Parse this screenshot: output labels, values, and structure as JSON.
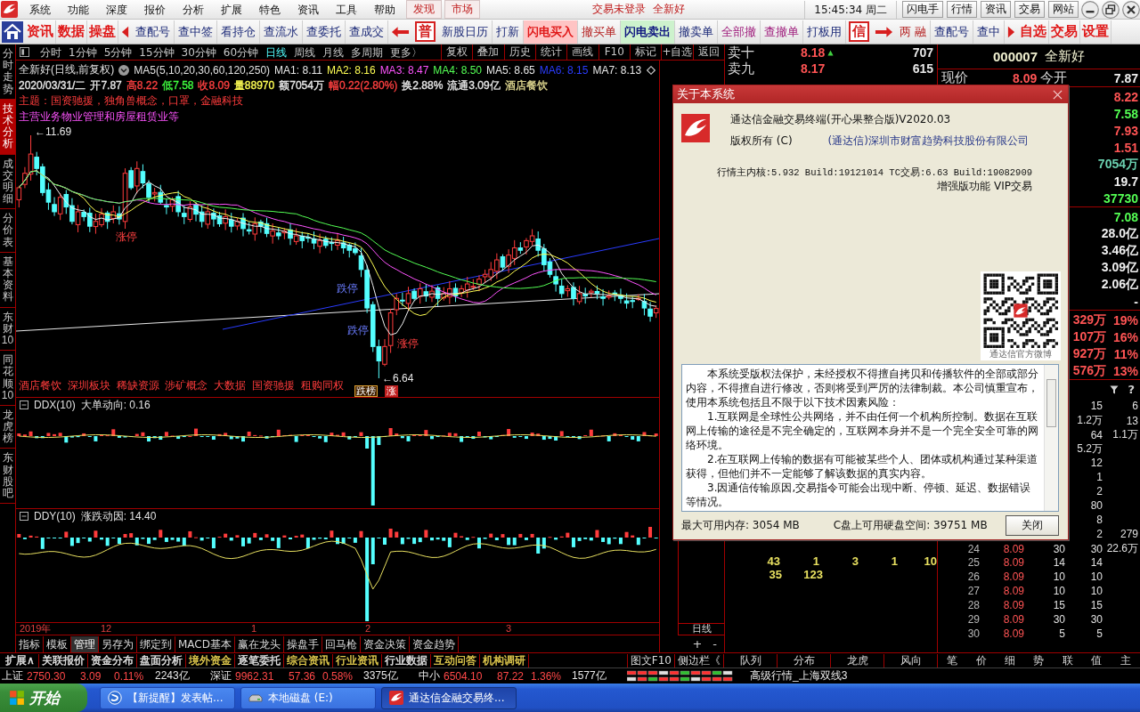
{
  "menu_bar": {
    "menus": [
      "系统",
      "功能",
      "深度",
      "报价",
      "分析",
      "扩展",
      "特色",
      "资讯",
      "工具",
      "帮助"
    ],
    "tabs": [
      "发现",
      "市场"
    ],
    "login_status": "交易未登录",
    "stock": "全新好",
    "clock": "15:45:34 周二",
    "buttons": [
      "闪电手",
      "行情",
      "资讯",
      "交易",
      "网站"
    ]
  },
  "toolbar": {
    "primary": [
      "资讯",
      "数据",
      "操盘"
    ],
    "queries": [
      "查配号",
      "查中签",
      "看持仓",
      "查流水",
      "查委托",
      "查成交"
    ],
    "mode_badge": "普",
    "trade": [
      {
        "label": "新股日历",
        "kind": "plain"
      },
      {
        "label": "打新",
        "kind": "plain"
      },
      {
        "label": "闪电买入",
        "kind": "buy"
      },
      {
        "label": "撤买单",
        "kind": "cancel"
      },
      {
        "label": "闪电卖出",
        "kind": "sell"
      },
      {
        "label": "撤卖单",
        "kind": "plain"
      },
      {
        "label": "全部撤",
        "kind": "revoke"
      },
      {
        "label": "查撤单",
        "kind": "revoke"
      },
      {
        "label": "打板用",
        "kind": "plain"
      }
    ],
    "credit_badge": "信",
    "credit": [
      {
        "label": "两 融",
        "kind": "cancel"
      },
      {
        "label": "查配号",
        "kind": "plain"
      },
      {
        "label": "查中",
        "kind": "plain"
      }
    ],
    "shortcuts": [
      "自选",
      "交易",
      "设置"
    ]
  },
  "side_tabs": [
    {
      "label": "分时走势",
      "selected": false
    },
    {
      "label": "技术分析",
      "selected": true
    },
    {
      "label": "成交明细",
      "selected": false
    },
    {
      "label": "分价表",
      "selected": false
    },
    {
      "label": "基本资料",
      "selected": false
    },
    {
      "label": "东财10",
      "selected": false
    },
    {
      "label": "同花顺10",
      "selected": false
    },
    {
      "label": "龙虎榜",
      "selected": false
    },
    {
      "label": "东财股吧",
      "selected": false
    }
  ],
  "period_tabs": [
    {
      "label": "分时",
      "selected": false
    },
    {
      "label": "1分钟",
      "selected": false
    },
    {
      "label": "5分钟",
      "selected": false
    },
    {
      "label": "15分钟",
      "selected": false
    },
    {
      "label": "30分钟",
      "selected": false
    },
    {
      "label": "60分钟",
      "selected": false
    },
    {
      "label": "日线",
      "selected": true
    },
    {
      "label": "周线",
      "selected": false
    },
    {
      "label": "月线",
      "selected": false
    },
    {
      "label": "多周期",
      "selected": false
    },
    {
      "label": "更多〉",
      "selected": false
    }
  ],
  "chart_tools": [
    "复权",
    "叠加",
    "历史",
    "统计",
    "画线",
    "F10",
    "标记",
    "+自选",
    "返回"
  ],
  "chart": {
    "title": "全新好(日线,前复权)",
    "indicator": "MA5(5,10,20,30,60,120,250)",
    "ma_values": [
      {
        "text": "MA1: 8.11",
        "color": "#e8e8e8"
      },
      {
        "text": "MA2: 8.16",
        "color": "#ffff54"
      },
      {
        "text": "MA3: 8.47",
        "color": "#ff54ff"
      },
      {
        "text": "MA4: 8.50",
        "color": "#54ff54"
      },
      {
        "text": "MA5: 8.65",
        "color": "#e8e8e8"
      },
      {
        "text": "MA6: 8.15",
        "color": "#2a3cff"
      },
      {
        "text": "MA7: 8.13",
        "color": "#e8e8e8"
      }
    ],
    "quote": [
      {
        "text": "2020/03/31/二",
        "color": "#e8e8e8"
      },
      {
        "text": "开7.87",
        "color": "#e8e8e8"
      },
      {
        "text": "高8.22",
        "color": "#ff4040"
      },
      {
        "text": "低7.58",
        "color": "#40ff40"
      },
      {
        "text": "收8.09",
        "color": "#ff4040"
      },
      {
        "text": "量88970",
        "color": "#ffff54"
      },
      {
        "text": "额7054万",
        "color": "#e8e8e8"
      },
      {
        "text": "幅0.22(2.80%)",
        "color": "#ff4040"
      },
      {
        "text": "换2.88%",
        "color": "#e8e8e8"
      },
      {
        "text": "流通3.09亿",
        "color": "#e8e8e8"
      },
      {
        "text": "酒店餐饮",
        "color": "#e0d890"
      }
    ],
    "theme": "主题：国资驰援，独角兽概念，口罩，金融科技",
    "business": "主营业务物业管理和房屋租赁业等",
    "marks": [
      {
        "text": "←11.69",
        "kind": "price"
      },
      {
        "text": "涨停",
        "kind": "limit-up"
      },
      {
        "text": "跌停",
        "kind": "limit-down"
      },
      {
        "text": "跌停",
        "kind": "limit-down"
      },
      {
        "text": "涨停",
        "kind": "limit-up"
      },
      {
        "text": "←6.64",
        "kind": "price"
      }
    ],
    "concepts": "酒店餐饮 深圳板块 稀缺资源 涉矿概念 大数据 国资驰援 租购同权",
    "tags": [
      {
        "text": "跌榜",
        "kind": "down"
      },
      {
        "text": "涨",
        "kind": "up"
      }
    ]
  },
  "indicators": [
    {
      "name": "DDX(10)",
      "reading": "大单动向: 0.16"
    },
    {
      "name": "DDY(10)",
      "reading": "涨跌动因: 14.40"
    }
  ],
  "date_axis": [
    "2019年",
    "12",
    "1",
    "2",
    "3"
  ],
  "indicator_tabs": [
    {
      "label": "指标",
      "selected": false
    },
    {
      "label": "模板",
      "selected": false
    },
    {
      "label": "管理",
      "selected": true
    },
    {
      "label": "另存为",
      "selected": false
    },
    {
      "label": "绑定到",
      "selected": false
    },
    {
      "label": "MACD基本",
      "selected": false
    },
    {
      "label": "赢在龙头",
      "selected": false
    },
    {
      "label": "操盘手",
      "selected": false
    },
    {
      "label": "回马枪",
      "selected": false
    },
    {
      "label": "资金决策",
      "selected": false
    },
    {
      "label": "资金趋势",
      "selected": false
    }
  ],
  "scale_panel": {
    "period": "日线",
    "zoom_buttons": [
      "+",
      "-"
    ]
  },
  "order_book": {
    "asks": [
      {
        "label": "卖十",
        "price": "8.18",
        "volume": "707",
        "rising": true
      },
      {
        "label": "卖九",
        "price": "8.17",
        "volume": "615",
        "rising": false
      }
    ],
    "queue": [
      [
        "43",
        "1",
        "3",
        "1",
        "10"
      ],
      [
        "35",
        "123"
      ]
    ]
  },
  "quote_panel": {
    "code": "000007",
    "name": "全新好",
    "first_row": [
      {
        "label": "现价",
        "value": "8.09",
        "rising": true
      },
      {
        "label": "今开",
        "value": "7.87",
        "rising": false
      }
    ],
    "stats": [
      {
        "text": "8.22",
        "color": "#ff5454"
      },
      {
        "text": "7.58",
        "color": "#54ff54"
      },
      {
        "text": "7.93",
        "color": "#ff5454"
      },
      {
        "text": "1.51",
        "color": "#ff5454"
      },
      {
        "text": "7054万",
        "color": "#6ad0b0"
      },
      {
        "text": "19.7",
        "color": "#f0f0f0"
      },
      {
        "text": "37730",
        "color": "#54ff54"
      }
    ],
    "capital": [
      {
        "text": "7.08",
        "color": "#54ff54"
      },
      {
        "text": "28.0亿",
        "color": "#f0f0f0"
      },
      {
        "text": "3.46亿",
        "color": "#f0f0f0"
      },
      {
        "text": "3.09亿",
        "color": "#f0f0f0"
      },
      {
        "text": "2.06亿",
        "color": "#f0f0f0"
      },
      {
        "text": "-",
        "color": "#f0f0f0"
      }
    ],
    "flows": [
      {
        "amount": "329万",
        "ratio": "19%"
      },
      {
        "amount": "107万",
        "ratio": "16%"
      },
      {
        "amount": "927万",
        "ratio": "11%"
      },
      {
        "amount": "576万",
        "ratio": "13%"
      }
    ]
  },
  "ticks": {
    "help": "?",
    "rows": [
      {
        "column_4": "15",
        "column_5": "6"
      },
      {
        "column_4": "1.2万",
        "column_5": "13"
      },
      {
        "column_4": "64",
        "column_5": "1.1万"
      },
      {
        "column_4": "5.2万"
      },
      {
        "column_4": "12"
      },
      {
        "column_4": "1"
      },
      {
        "column_4": "2"
      },
      {
        "column_4": "80"
      },
      {
        "column_4": "8"
      },
      {
        "column_4": "2",
        "column_5": "279"
      },
      {
        "column_1": "24",
        "column_2": "8.09",
        "column_3": "30",
        "column_4": "30",
        "column_5": "22.6万"
      },
      {
        "column_1": "25",
        "column_2": "8.09",
        "column_3": "14",
        "column_4": "14"
      },
      {
        "column_1": "26",
        "column_2": "8.09",
        "column_3": "10",
        "column_4": "10"
      },
      {
        "column_1": "27",
        "column_2": "8.09",
        "column_3": "10",
        "column_4": "10"
      },
      {
        "column_1": "28",
        "column_2": "8.09",
        "column_3": "15",
        "column_4": "15"
      },
      {
        "column_1": "29",
        "column_2": "8.09",
        "column_3": "30",
        "column_4": "30"
      },
      {
        "column_1": "30",
        "column_2": "8.09",
        "column_3": "5",
        "column_4": "5"
      }
    ]
  },
  "info_tabs": [
    {
      "label": "扩展∧",
      "color": "#e8e8e8"
    },
    {
      "label": "关联报价",
      "color": "#e8e8e8"
    },
    {
      "label": "资金分布",
      "color": "#e8e8e8"
    },
    {
      "label": "盘面分析",
      "color": "#e8e8e8"
    },
    {
      "label": "境外资金",
      "color": "#e8d050"
    },
    {
      "label": "逐笔委托",
      "color": "#e8e8e8"
    },
    {
      "label": "综合资讯",
      "color": "#e8d050"
    },
    {
      "label": "行业资讯",
      "color": "#e8d050"
    },
    {
      "label": "行业数据",
      "color": "#e8e8e8"
    },
    {
      "label": "互动问答",
      "color": "#e8d050"
    },
    {
      "label": "机构调研",
      "color": "#e8d050"
    }
  ],
  "side_links": [
    "图文F10",
    "侧边栏《"
  ],
  "panel_tabs": [
    "队列",
    "分布",
    "龙虎",
    "风向"
  ],
  "detail_tabs": [
    "笔",
    "价",
    "细",
    "势",
    "联",
    "值",
    "主"
  ],
  "status_bar": {
    "indices": [
      {
        "name": "上证",
        "value": "2750.30",
        "change": "3.09",
        "percent": "0.11%",
        "amount": "2243亿",
        "rising": true
      },
      {
        "name": "深证",
        "value": "9962.31",
        "change": "57.36",
        "percent": "0.58%",
        "amount": "3375亿",
        "rising": true
      },
      {
        "name": "中小",
        "value": "6504.10",
        "change": "87.22",
        "percent": "1.36%",
        "amount": "1577亿",
        "rising": true
      }
    ],
    "feed": "高级行情_上海双线3"
  },
  "taskbar": {
    "start": "开始",
    "tasks": [
      {
        "label": "【新提醒】发表帖...",
        "kind": "browser",
        "selected": false
      },
      {
        "label": "本地磁盘 (E:)",
        "kind": "drive",
        "selected": false
      },
      {
        "label": "通达信金融交易终...",
        "kind": "app",
        "selected": true
      }
    ]
  },
  "about_dialog": {
    "title": "关于本系统",
    "product": "通达信金融交易终端(开心果整合版)V2020.03",
    "copyright": "版权所有 (C)",
    "company": "(通达信)深圳市财富趋势科技股份有限公司",
    "versions": "行情主内核:5.932 Build:19121014 TC交易:6.63 Build:19082909",
    "edition": "增强版功能 VIP交易",
    "qr_caption": "通达信官方微博",
    "notice": [
      "本系统受版权法保护，未经授权不得擅自拷贝和传播软件的全部或部分内容，不得擅自进行修改，否则将受到严厉的法律制裁。本公司慎重宣布，使用本系统包括且不限于以下技术因素风险：",
      "1.互联网是全球性公共网络，并不由任何一个机构所控制。数据在互联网上传输的途径是不完全确定的，互联网本身并不是一个完全安全可靠的网络环境。",
      "2.在互联网上传输的数据有可能被某些个人、团体或机构通过某种渠道获得，但他们并不一定能够了解该数据的真实内容。",
      "3.因通信传输原因,交易指令可能会出现中断、停顿、延迟、数据错误等情况。"
    ],
    "memory": "最大可用内存: 3054 MB",
    "disk": "C盘上可用硬盘空间: 39751 MB",
    "close": "关闭"
  }
}
